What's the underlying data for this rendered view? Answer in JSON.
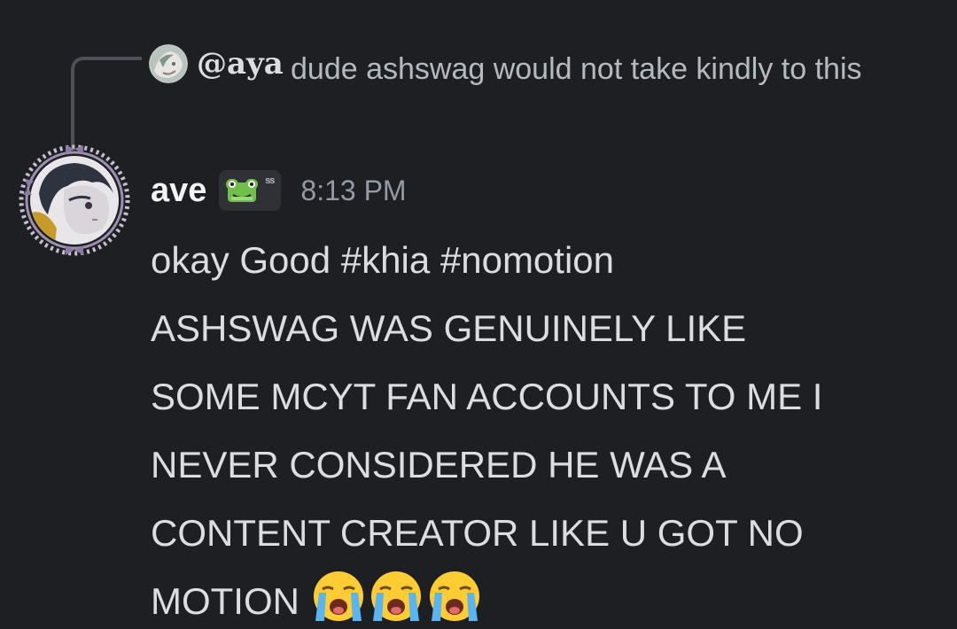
{
  "reply": {
    "username": "@aya",
    "text": "dude ashswag would not take kindly to this"
  },
  "message": {
    "author": "ave",
    "tag": "ss",
    "timestamp": "8:13 PM",
    "lines": [
      "okay Good #khia #nomotion",
      "ASHSWAG WAS GENUINELY LIKE",
      "SOME MCYT FAN ACCOUNTS TO ME I",
      "NEVER CONSIDERED HE WAS A",
      "CONTENT CREATOR LIKE U GOT NO",
      "MOTION"
    ],
    "emoji": [
      "loudly-crying-face",
      "loudly-crying-face",
      "loudly-crying-face"
    ]
  },
  "colors": {
    "background": "#1e1f22",
    "text": "#dbdee1",
    "muted": "#949ba4",
    "name": "#f2f3f5"
  }
}
